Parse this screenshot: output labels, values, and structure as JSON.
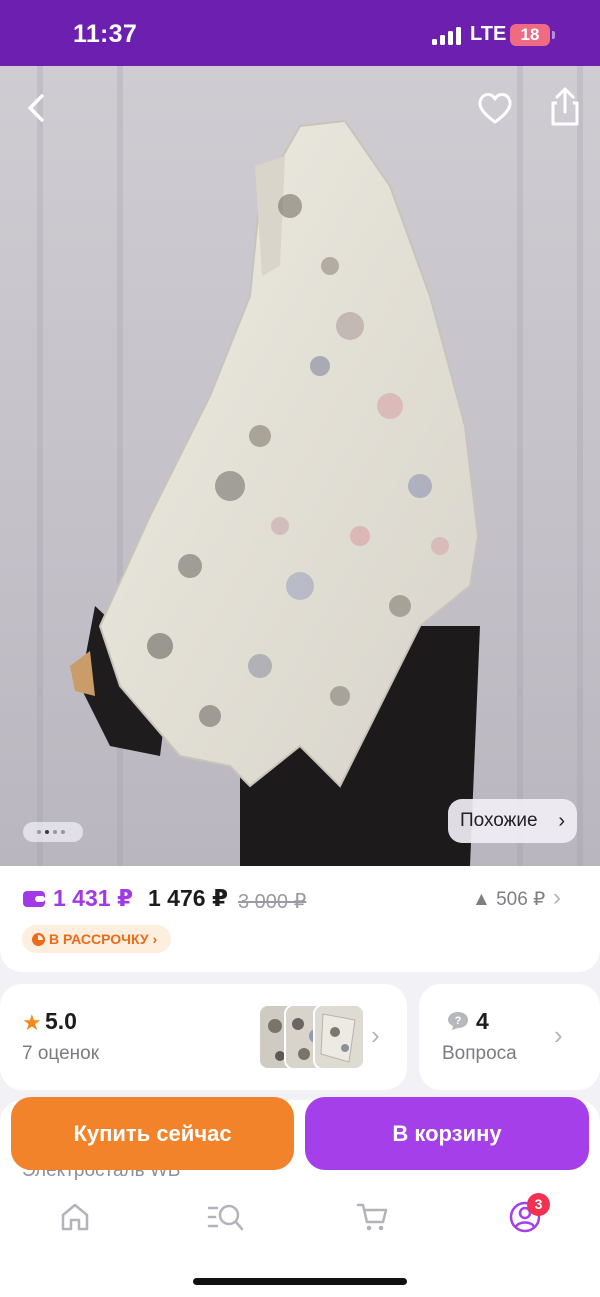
{
  "status_bar": {
    "time": "11:37",
    "network": "LTE",
    "battery": "18"
  },
  "hero": {
    "back_icon": "chevron-left-icon",
    "favorite_icon": "heart-icon",
    "share_icon": "share-icon",
    "similar_label": "Похожие",
    "gallery_dots": 4
  },
  "price": {
    "wallet_price": "1 431 ₽",
    "price": "1 476 ₽",
    "old_price": "3 000 ₽",
    "difference": "506 ₽",
    "installment_label": "В РАССРОЧКУ"
  },
  "rating": {
    "value": "5.0",
    "count_label": "7 оценок"
  },
  "questions": {
    "value": "4",
    "label": "Вопроса"
  },
  "seller": {
    "text": "Электросталь WB"
  },
  "actions": {
    "buy_now": "Купить сейчас",
    "add_to_cart": "В корзину"
  },
  "tabbar": {
    "items": [
      {
        "icon": "home-icon"
      },
      {
        "icon": "catalog-search-icon"
      },
      {
        "icon": "cart-icon"
      },
      {
        "icon": "profile-icon"
      }
    ],
    "profile_badge": "3"
  },
  "colors": {
    "brand": "#6d1fb0",
    "accent_purple": "#a43fea",
    "accent_orange": "#f3832a",
    "badge": "#f0314f"
  }
}
